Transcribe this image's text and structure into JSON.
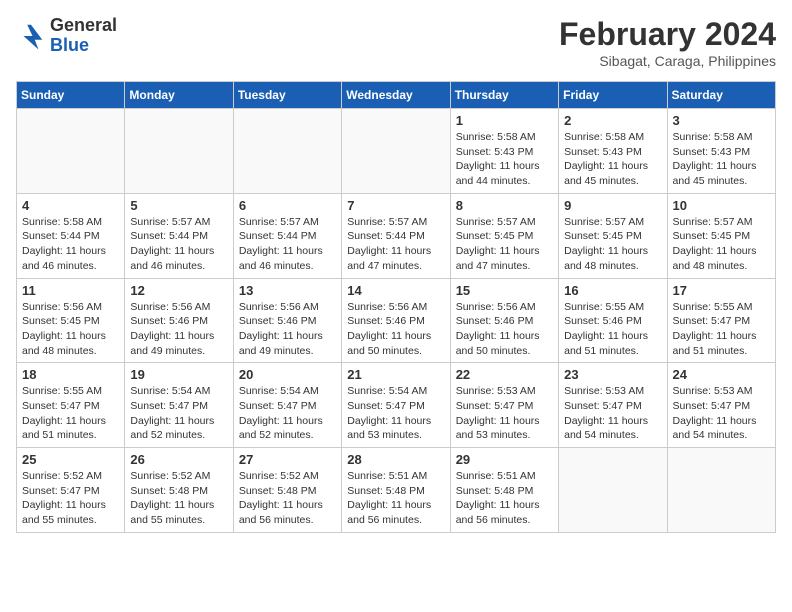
{
  "header": {
    "logo_general": "General",
    "logo_blue": "Blue",
    "month_year": "February 2024",
    "location": "Sibagat, Caraga, Philippines"
  },
  "weekdays": [
    "Sunday",
    "Monday",
    "Tuesday",
    "Wednesday",
    "Thursday",
    "Friday",
    "Saturday"
  ],
  "weeks": [
    [
      {
        "day": "",
        "info": ""
      },
      {
        "day": "",
        "info": ""
      },
      {
        "day": "",
        "info": ""
      },
      {
        "day": "",
        "info": ""
      },
      {
        "day": "1",
        "info": "Sunrise: 5:58 AM\nSunset: 5:43 PM\nDaylight: 11 hours\nand 44 minutes."
      },
      {
        "day": "2",
        "info": "Sunrise: 5:58 AM\nSunset: 5:43 PM\nDaylight: 11 hours\nand 45 minutes."
      },
      {
        "day": "3",
        "info": "Sunrise: 5:58 AM\nSunset: 5:43 PM\nDaylight: 11 hours\nand 45 minutes."
      }
    ],
    [
      {
        "day": "4",
        "info": "Sunrise: 5:58 AM\nSunset: 5:44 PM\nDaylight: 11 hours\nand 46 minutes."
      },
      {
        "day": "5",
        "info": "Sunrise: 5:57 AM\nSunset: 5:44 PM\nDaylight: 11 hours\nand 46 minutes."
      },
      {
        "day": "6",
        "info": "Sunrise: 5:57 AM\nSunset: 5:44 PM\nDaylight: 11 hours\nand 46 minutes."
      },
      {
        "day": "7",
        "info": "Sunrise: 5:57 AM\nSunset: 5:44 PM\nDaylight: 11 hours\nand 47 minutes."
      },
      {
        "day": "8",
        "info": "Sunrise: 5:57 AM\nSunset: 5:45 PM\nDaylight: 11 hours\nand 47 minutes."
      },
      {
        "day": "9",
        "info": "Sunrise: 5:57 AM\nSunset: 5:45 PM\nDaylight: 11 hours\nand 48 minutes."
      },
      {
        "day": "10",
        "info": "Sunrise: 5:57 AM\nSunset: 5:45 PM\nDaylight: 11 hours\nand 48 minutes."
      }
    ],
    [
      {
        "day": "11",
        "info": "Sunrise: 5:56 AM\nSunset: 5:45 PM\nDaylight: 11 hours\nand 48 minutes."
      },
      {
        "day": "12",
        "info": "Sunrise: 5:56 AM\nSunset: 5:46 PM\nDaylight: 11 hours\nand 49 minutes."
      },
      {
        "day": "13",
        "info": "Sunrise: 5:56 AM\nSunset: 5:46 PM\nDaylight: 11 hours\nand 49 minutes."
      },
      {
        "day": "14",
        "info": "Sunrise: 5:56 AM\nSunset: 5:46 PM\nDaylight: 11 hours\nand 50 minutes."
      },
      {
        "day": "15",
        "info": "Sunrise: 5:56 AM\nSunset: 5:46 PM\nDaylight: 11 hours\nand 50 minutes."
      },
      {
        "day": "16",
        "info": "Sunrise: 5:55 AM\nSunset: 5:46 PM\nDaylight: 11 hours\nand 51 minutes."
      },
      {
        "day": "17",
        "info": "Sunrise: 5:55 AM\nSunset: 5:47 PM\nDaylight: 11 hours\nand 51 minutes."
      }
    ],
    [
      {
        "day": "18",
        "info": "Sunrise: 5:55 AM\nSunset: 5:47 PM\nDaylight: 11 hours\nand 51 minutes."
      },
      {
        "day": "19",
        "info": "Sunrise: 5:54 AM\nSunset: 5:47 PM\nDaylight: 11 hours\nand 52 minutes."
      },
      {
        "day": "20",
        "info": "Sunrise: 5:54 AM\nSunset: 5:47 PM\nDaylight: 11 hours\nand 52 minutes."
      },
      {
        "day": "21",
        "info": "Sunrise: 5:54 AM\nSunset: 5:47 PM\nDaylight: 11 hours\nand 53 minutes."
      },
      {
        "day": "22",
        "info": "Sunrise: 5:53 AM\nSunset: 5:47 PM\nDaylight: 11 hours\nand 53 minutes."
      },
      {
        "day": "23",
        "info": "Sunrise: 5:53 AM\nSunset: 5:47 PM\nDaylight: 11 hours\nand 54 minutes."
      },
      {
        "day": "24",
        "info": "Sunrise: 5:53 AM\nSunset: 5:47 PM\nDaylight: 11 hours\nand 54 minutes."
      }
    ],
    [
      {
        "day": "25",
        "info": "Sunrise: 5:52 AM\nSunset: 5:47 PM\nDaylight: 11 hours\nand 55 minutes."
      },
      {
        "day": "26",
        "info": "Sunrise: 5:52 AM\nSunset: 5:48 PM\nDaylight: 11 hours\nand 55 minutes."
      },
      {
        "day": "27",
        "info": "Sunrise: 5:52 AM\nSunset: 5:48 PM\nDaylight: 11 hours\nand 56 minutes."
      },
      {
        "day": "28",
        "info": "Sunrise: 5:51 AM\nSunset: 5:48 PM\nDaylight: 11 hours\nand 56 minutes."
      },
      {
        "day": "29",
        "info": "Sunrise: 5:51 AM\nSunset: 5:48 PM\nDaylight: 11 hours\nand 56 minutes."
      },
      {
        "day": "",
        "info": ""
      },
      {
        "day": "",
        "info": ""
      }
    ]
  ]
}
